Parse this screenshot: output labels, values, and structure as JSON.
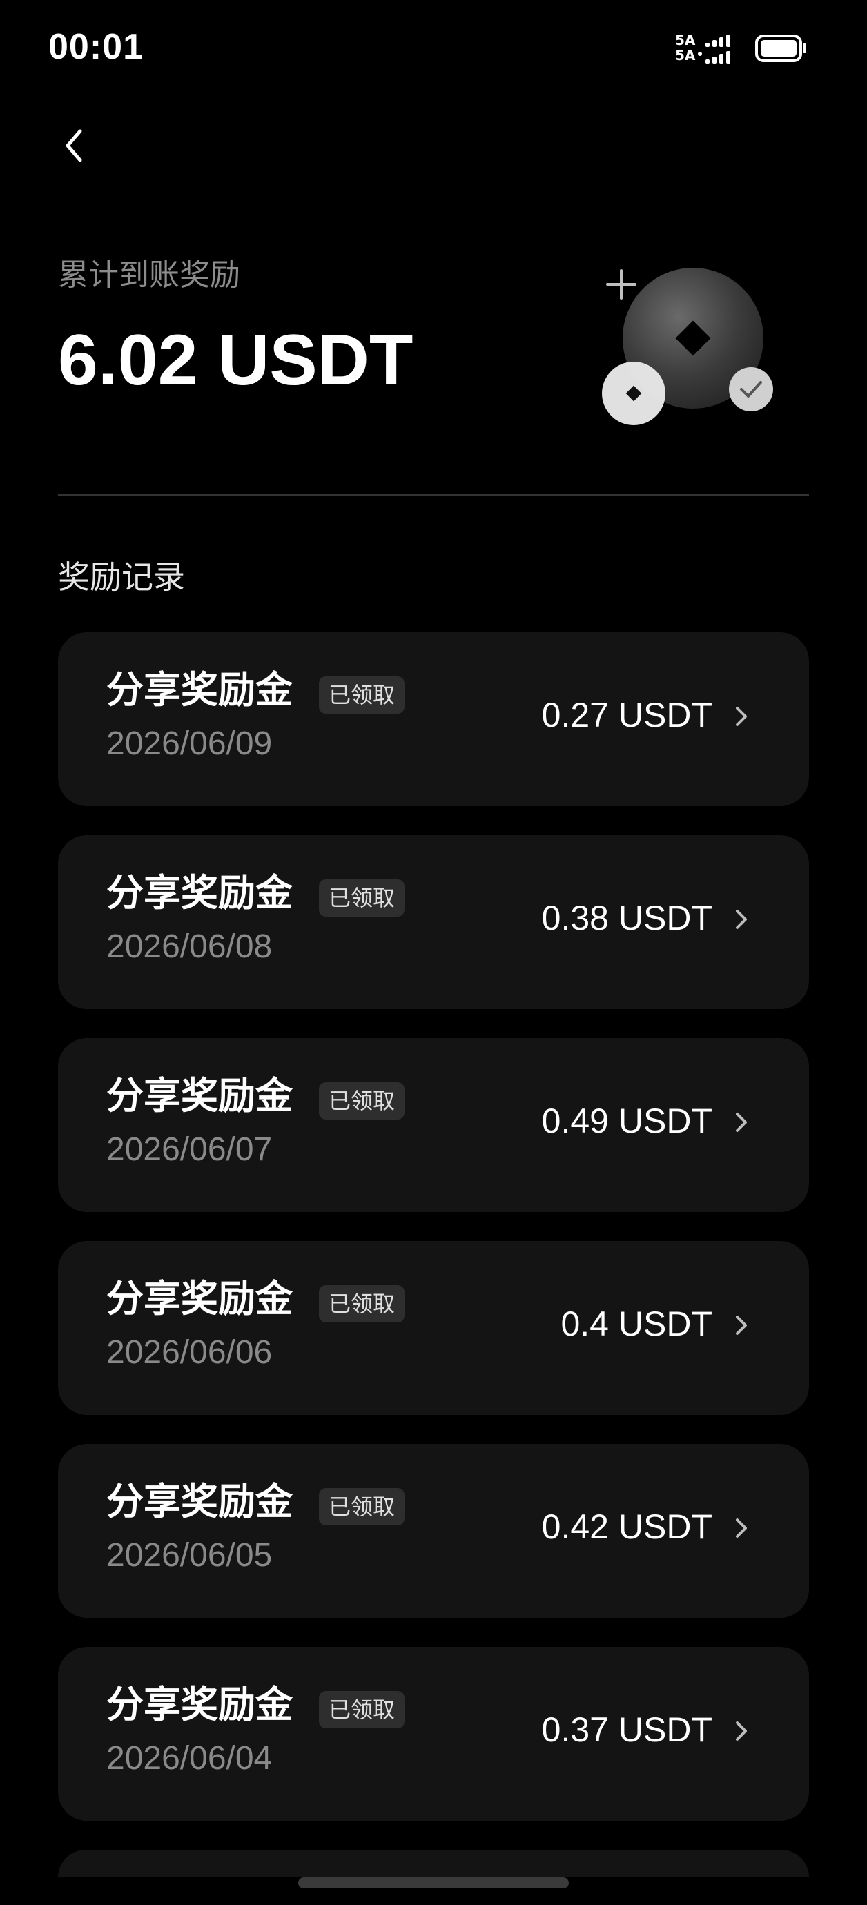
{
  "status_bar": {
    "time": "00:01",
    "signal_line1": "5A",
    "signal_line2": "5A"
  },
  "summary": {
    "label": "累计到账奖励",
    "amount": "6.02 USDT"
  },
  "section": {
    "title": "奖励记录"
  },
  "records": [
    {
      "title": "分享奖励金",
      "badge": "已领取",
      "date": "2026/06/09",
      "amount": "0.27 USDT"
    },
    {
      "title": "分享奖励金",
      "badge": "已领取",
      "date": "2026/06/08",
      "amount": "0.38 USDT"
    },
    {
      "title": "分享奖励金",
      "badge": "已领取",
      "date": "2026/06/07",
      "amount": "0.49 USDT"
    },
    {
      "title": "分享奖励金",
      "badge": "已领取",
      "date": "2026/06/06",
      "amount": "0.4 USDT"
    },
    {
      "title": "分享奖励金",
      "badge": "已领取",
      "date": "2026/06/05",
      "amount": "0.42 USDT"
    },
    {
      "title": "分享奖励金",
      "badge": "已领取",
      "date": "2026/06/04",
      "amount": "0.37 USDT"
    }
  ],
  "icons": {
    "back": "chevron-left-icon",
    "record_arrow": "chevron-right-icon",
    "illustration": "coin-reward-icon"
  },
  "colors": {
    "background": "#000000",
    "card": "#141414",
    "muted_text": "#8c8c8c",
    "badge_bg": "#2e2e2e"
  }
}
